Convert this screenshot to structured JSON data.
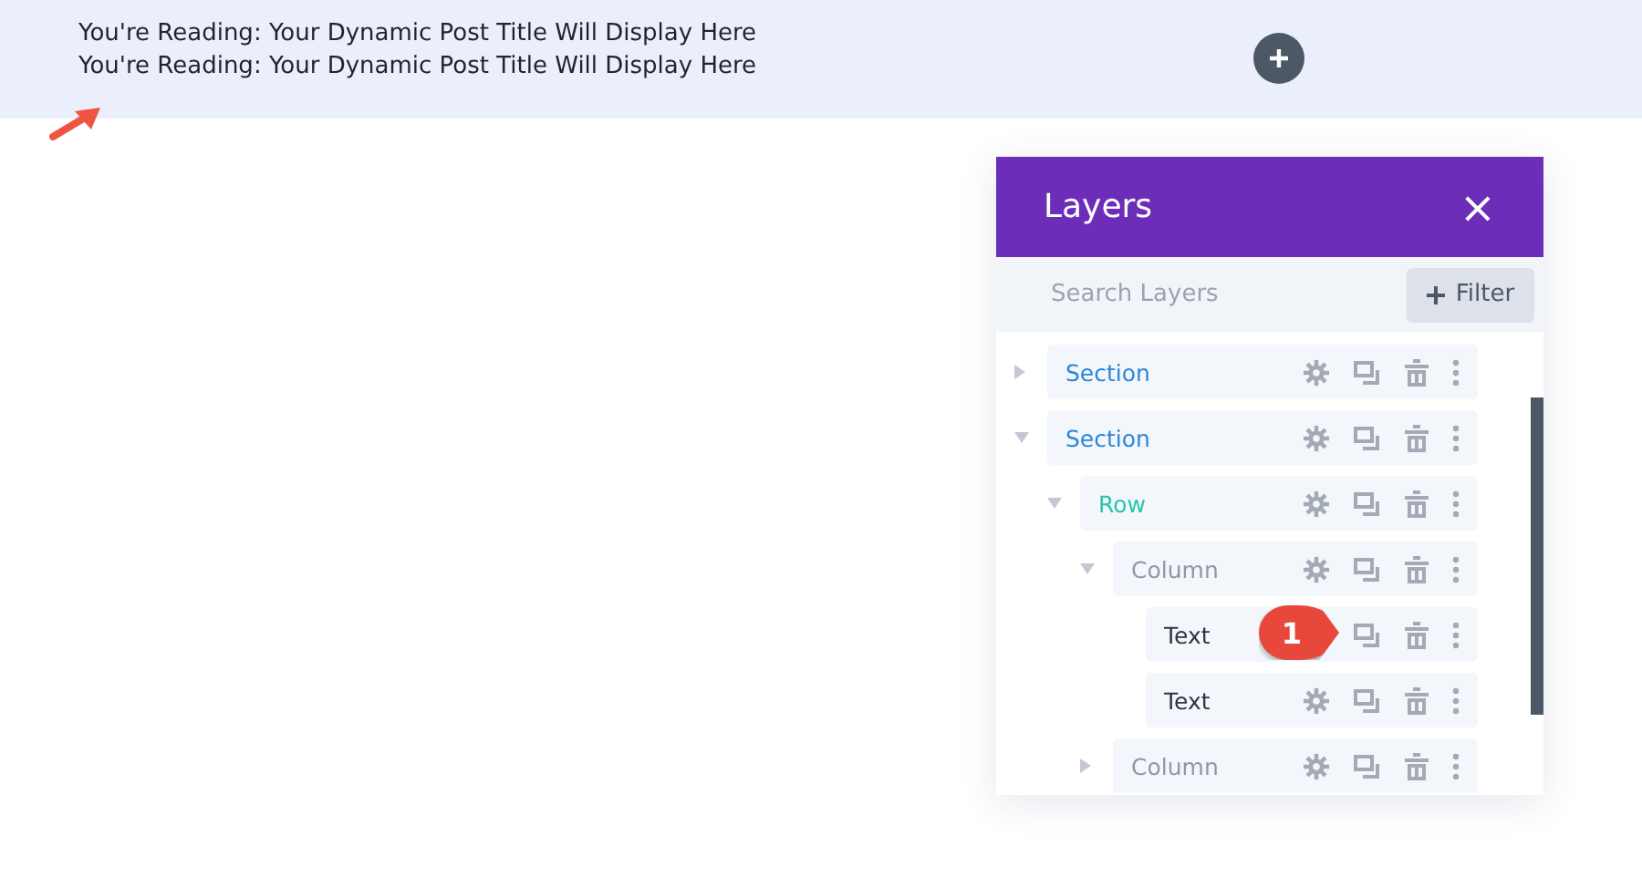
{
  "banner": {
    "lines": [
      "You're Reading: Your Dynamic Post Title Will Display Here",
      "You're Reading: Your Dynamic Post Title Will Display Here"
    ]
  },
  "layers_panel": {
    "title": "Layers",
    "close": "×",
    "search": {
      "placeholder": "Search Layers"
    },
    "filter_button": {
      "label": "Filter"
    },
    "tree": [
      {
        "kind": "section",
        "label": "Section",
        "expanded": false
      },
      {
        "kind": "section",
        "label": "Section",
        "expanded": true,
        "children": [
          {
            "kind": "row",
            "label": "Row",
            "expanded": true,
            "children": [
              {
                "kind": "column",
                "label": "Column",
                "expanded": true,
                "children": [
                  {
                    "kind": "module",
                    "label": "Text",
                    "callout": "1"
                  },
                  {
                    "kind": "module",
                    "label": "Text"
                  }
                ]
              },
              {
                "kind": "column",
                "label": "Column",
                "expanded": false
              }
            ]
          }
        ]
      }
    ]
  }
}
